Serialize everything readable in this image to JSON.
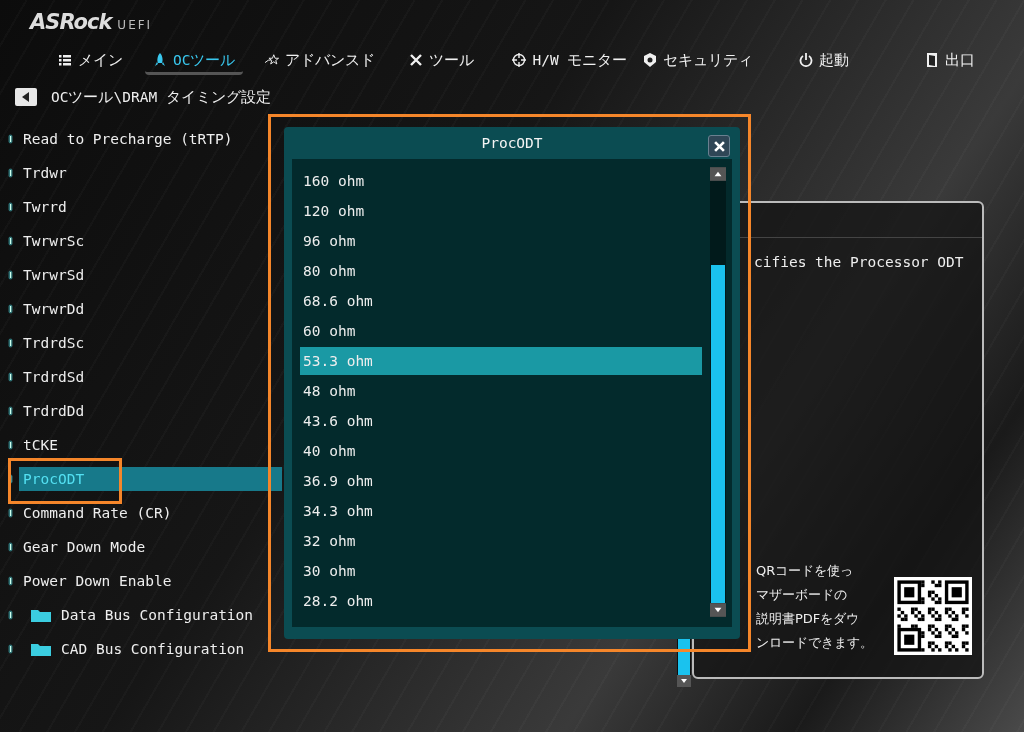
{
  "header": {
    "logo": "ASRock",
    "logo_suffix": "UEFI"
  },
  "tabs": [
    {
      "label": "メイン",
      "selected": false
    },
    {
      "label": "OCツール",
      "selected": true
    },
    {
      "label": "アドバンスド",
      "selected": false
    },
    {
      "label": "ツール",
      "selected": false
    },
    {
      "label": "H/W モニター",
      "selected": false
    },
    {
      "label": "セキュリティ",
      "selected": false
    },
    {
      "label": "起動",
      "selected": false
    },
    {
      "label": "出口",
      "selected": false
    }
  ],
  "breadcrumb": "OCツール\\DRAM タイミング設定",
  "settings": [
    {
      "label": "Read to Precharge (tRTP)",
      "kind": "setting",
      "selected": false
    },
    {
      "label": "Trdwr",
      "kind": "setting",
      "selected": false
    },
    {
      "label": "Twrrd",
      "kind": "setting",
      "selected": false
    },
    {
      "label": "TwrwrSc",
      "kind": "setting",
      "selected": false
    },
    {
      "label": "TwrwrSd",
      "kind": "setting",
      "selected": false
    },
    {
      "label": "TwrwrDd",
      "kind": "setting",
      "selected": false
    },
    {
      "label": "TrdrdSc",
      "kind": "setting",
      "selected": false
    },
    {
      "label": "TrdrdSd",
      "kind": "setting",
      "selected": false
    },
    {
      "label": "TrdrdDd",
      "kind": "setting",
      "selected": false
    },
    {
      "label": "tCKE",
      "kind": "setting",
      "selected": false
    },
    {
      "label": "ProcODT",
      "kind": "setting",
      "selected": true
    },
    {
      "label": "Command Rate (CR)",
      "kind": "setting",
      "selected": false
    },
    {
      "label": "Gear Down Mode",
      "kind": "setting",
      "selected": false
    },
    {
      "label": "Power Down Enable",
      "kind": "setting",
      "selected": false
    },
    {
      "label": "Data Bus Configuration",
      "kind": "folder",
      "selected": false
    },
    {
      "label": "CAD Bus Configuration",
      "kind": "folder",
      "selected": false
    }
  ],
  "dialog": {
    "title": "ProcODT",
    "options": [
      {
        "label": "160 ohm",
        "selected": false
      },
      {
        "label": "120 ohm",
        "selected": false
      },
      {
        "label": "96 ohm",
        "selected": false
      },
      {
        "label": "80 ohm",
        "selected": false
      },
      {
        "label": "68.6 ohm",
        "selected": false
      },
      {
        "label": "60 ohm",
        "selected": false
      },
      {
        "label": "53.3 ohm",
        "selected": true
      },
      {
        "label": "48 ohm",
        "selected": false
      },
      {
        "label": "43.6 ohm",
        "selected": false
      },
      {
        "label": "40 ohm",
        "selected": false
      },
      {
        "label": "36.9 ohm",
        "selected": false
      },
      {
        "label": "34.3 ohm",
        "selected": false
      },
      {
        "label": "32 ohm",
        "selected": false
      },
      {
        "label": "30 ohm",
        "selected": false
      },
      {
        "label": "28.2 ohm",
        "selected": false
      }
    ]
  },
  "description": {
    "text": "cifies the Processor ODT",
    "qr_lines": [
      "QRコードを使っ",
      "マザーボードの",
      "説明書PDFをダウ",
      "ンロードできます。"
    ]
  }
}
